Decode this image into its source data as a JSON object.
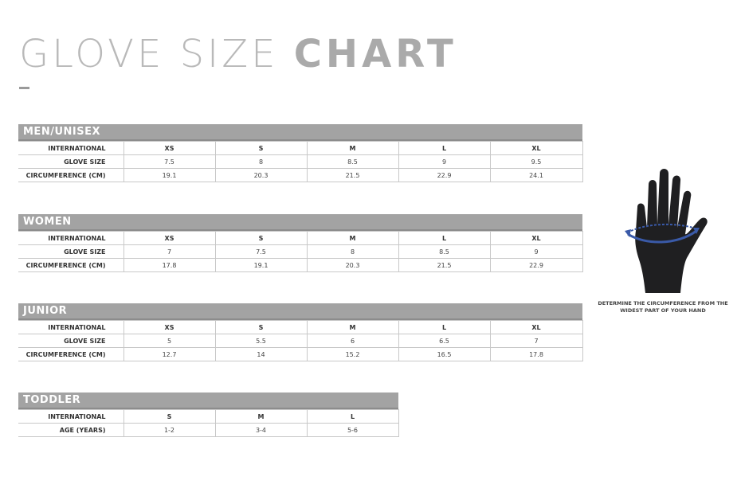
{
  "title": {
    "light": "GLOVE SIZE",
    "bold": "CHART"
  },
  "sections": [
    {
      "name": "MEN/UNISEX",
      "rows": [
        {
          "label": "INTERNATIONAL",
          "cells": [
            "XS",
            "S",
            "M",
            "L",
            "XL"
          ]
        },
        {
          "label": "GLOVE SIZE",
          "cells": [
            "7.5",
            "8",
            "8.5",
            "9",
            "9.5"
          ]
        },
        {
          "label": "CIRCUMFERENCE (CM)",
          "cells": [
            "19.1",
            "20.3",
            "21.5",
            "22.9",
            "24.1"
          ]
        }
      ]
    },
    {
      "name": "WOMEN",
      "rows": [
        {
          "label": "INTERNATIONAL",
          "cells": [
            "XS",
            "S",
            "M",
            "L",
            "XL"
          ]
        },
        {
          "label": "GLOVE SIZE",
          "cells": [
            "7",
            "7.5",
            "8",
            "8.5",
            "9"
          ]
        },
        {
          "label": "CIRCUMFERENCE (CM)",
          "cells": [
            "17.8",
            "19.1",
            "20.3",
            "21.5",
            "22.9"
          ]
        }
      ]
    },
    {
      "name": "JUNIOR",
      "rows": [
        {
          "label": "INTERNATIONAL",
          "cells": [
            "XS",
            "S",
            "M",
            "L",
            "XL"
          ]
        },
        {
          "label": "GLOVE SIZE",
          "cells": [
            "5",
            "5.5",
            "6",
            "6.5",
            "7"
          ]
        },
        {
          "label": "CIRCUMFERENCE (CM)",
          "cells": [
            "12.7",
            "14",
            "15.2",
            "16.5",
            "17.8"
          ]
        }
      ]
    },
    {
      "name": "TODDLER",
      "rows": [
        {
          "label": "INTERNATIONAL",
          "cells": [
            "S",
            "M",
            "L"
          ]
        },
        {
          "label": "AGE (YEARS)",
          "cells": [
            "1-2",
            "3-4",
            "5-6"
          ]
        }
      ]
    }
  ],
  "hand": {
    "icon": "hand-measure-icon",
    "caption_line1": "DETERMINE THE CIRCUMFERENCE FROM THE",
    "caption_line2": "WIDEST PART OF YOUR HAND",
    "accent": "#3a5aa8"
  }
}
